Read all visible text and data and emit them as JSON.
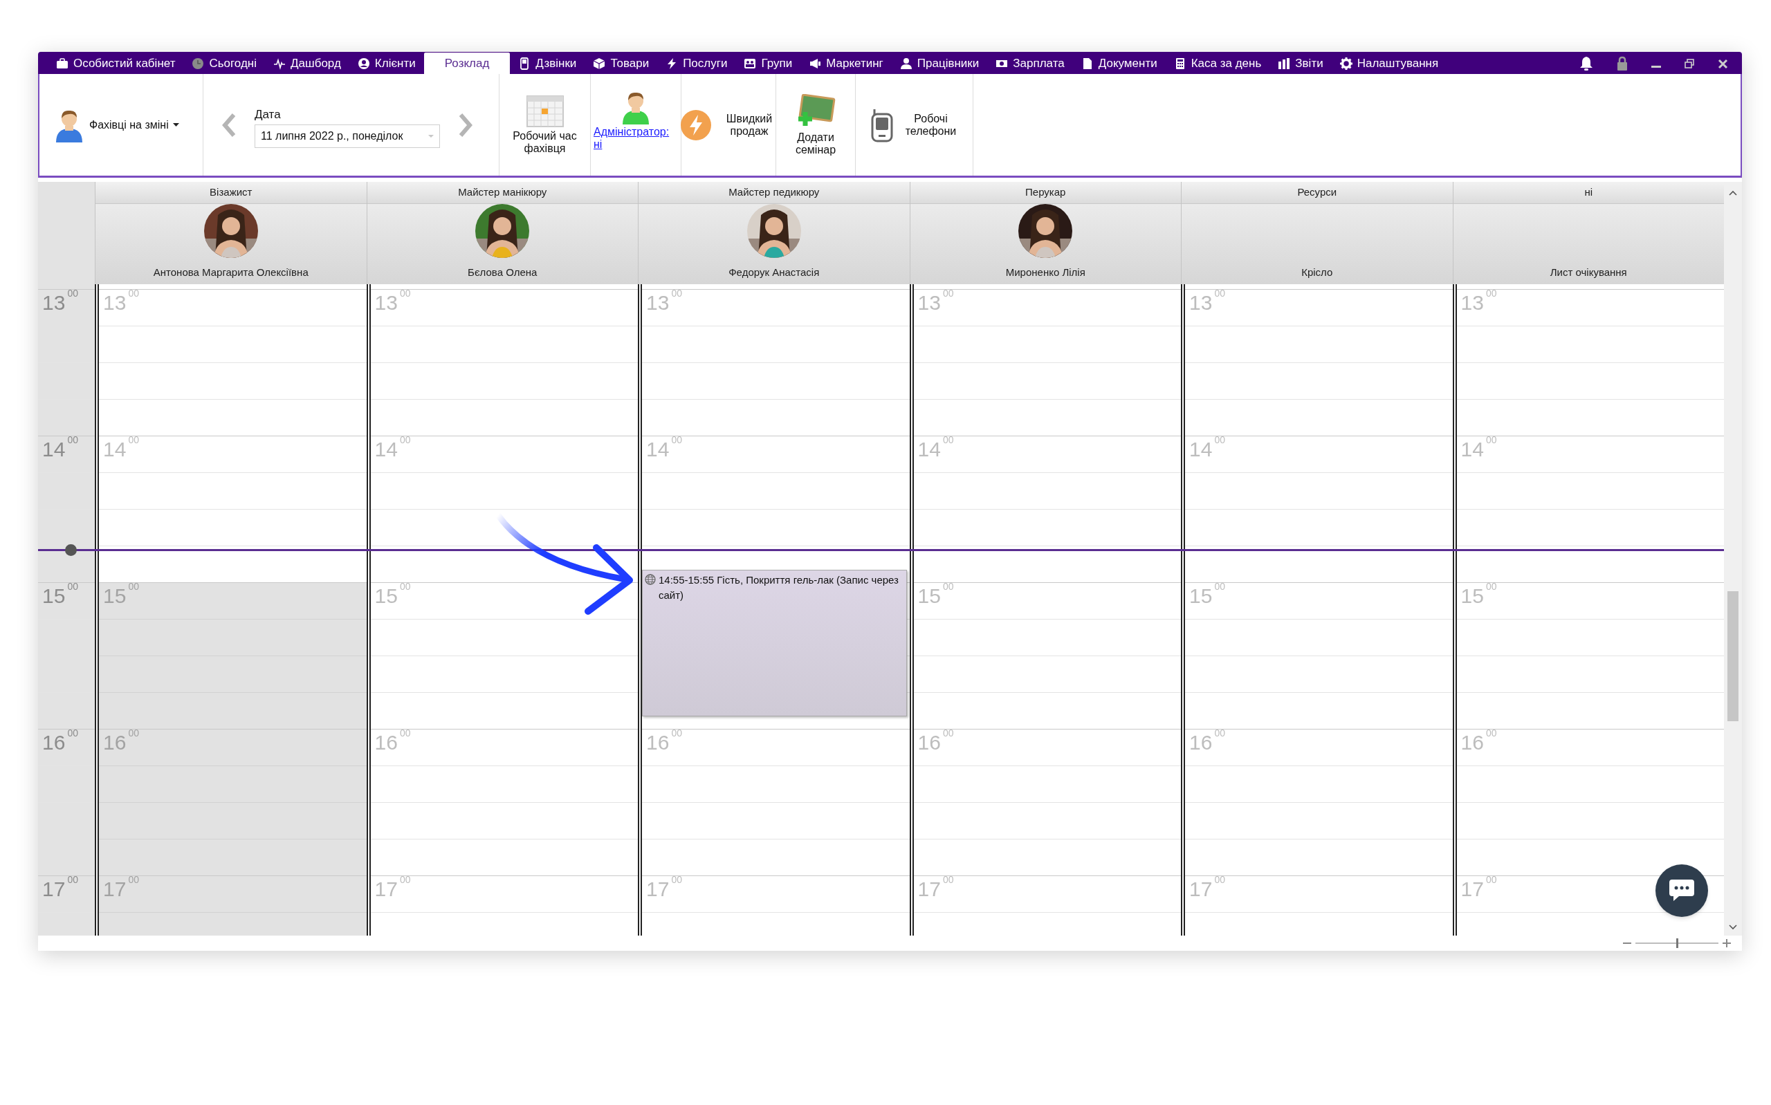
{
  "menu": [
    {
      "label": "Особистий кабінет",
      "selected": false
    },
    {
      "label": "Сьогодні",
      "selected": false
    },
    {
      "label": "Дашборд",
      "selected": false
    },
    {
      "label": "Клієнти",
      "selected": false
    },
    {
      "label": "Розклад",
      "selected": true
    },
    {
      "label": "Дзвінки",
      "selected": false
    },
    {
      "label": "Товари",
      "selected": false
    },
    {
      "label": "Послуги",
      "selected": false
    },
    {
      "label": "Групи",
      "selected": false
    },
    {
      "label": "Маркетинг",
      "selected": false
    },
    {
      "label": "Працівники",
      "selected": false
    },
    {
      "label": "Зарплата",
      "selected": false
    },
    {
      "label": "Документи",
      "selected": false
    },
    {
      "label": "Каса за день",
      "selected": false
    },
    {
      "label": "Звіти",
      "selected": false
    },
    {
      "label": "Налаштування",
      "selected": false
    }
  ],
  "toolbar": {
    "staff_button": "Фахівці на зміні",
    "date_label": "Дата",
    "date_value": "11 липня 2022 р., понеділок",
    "tools": [
      {
        "label": "Робочий час фахівця",
        "kind": "stacked"
      },
      {
        "label": "Адміністратор: ні",
        "kind": "link"
      },
      {
        "label": "Швидкий продаж",
        "kind": "inline"
      },
      {
        "label": "Додати семінар",
        "kind": "stacked"
      },
      {
        "label": "Робочі телефони",
        "kind": "inline"
      }
    ]
  },
  "time_gutter": [
    "13$^{00}$",
    "14$^{00}$",
    "15$^{00}$",
    "16$^{00}$",
    "17$^{00}$"
  ],
  "columns": [
    {
      "role": "Візажист",
      "name": "Антонова Маргарита Олексіївна",
      "photo": true,
      "hours": [
        {
          "label": "13$^{00}$",
          "off": false
        },
        {
          "label": "14$^{00}$",
          "off": false
        },
        {
          "label": "15$^{00}$",
          "off": true
        },
        {
          "label": "16$^{00}$",
          "off": true
        },
        {
          "label": "17$^{00}$",
          "off": true
        }
      ]
    },
    {
      "role": "Майстер манікюру",
      "name": "Бєлова Олена",
      "photo": true,
      "hours": [
        {
          "label": "13$^{00}$",
          "off": false
        },
        {
          "label": "14$^{00}$",
          "off": false
        },
        {
          "label": "15$^{00}$",
          "off": false
        },
        {
          "label": "16$^{00}$",
          "off": false
        },
        {
          "label": "17$^{00}$",
          "off": false
        }
      ]
    },
    {
      "role": "Майстер педикюру",
      "name": "Федорук Анастасія",
      "photo": true,
      "hours": [
        {
          "label": "13$^{00}$",
          "off": false
        },
        {
          "label": "14$^{00}$",
          "off": false
        },
        {
          "off": false
        },
        {
          "label": "16$^{00}$",
          "off": false
        },
        {
          "label": "17$^{00}$",
          "off": false
        }
      ],
      "appointments": [
        {
          "text": "14:55-15:55 Гість, Покриття гель-лак (Запис через сайт)"
        }
      ]
    },
    {
      "role": "Перукар",
      "name": "Мироненко Лілія",
      "photo": true,
      "hours": [
        {
          "label": "13$^{00}$",
          "off": false
        },
        {
          "label": "14$^{00}$",
          "off": false
        },
        {
          "label": "15$^{00}$",
          "off": false
        },
        {
          "label": "16$^{00}$",
          "off": false
        },
        {
          "label": "17$^{00}$",
          "off": false
        }
      ]
    },
    {
      "role": "Ресурси",
      "name": "Крісло",
      "photo": false,
      "hours": [
        {
          "label": "13$^{00}$",
          "off": false
        },
        {
          "label": "14$^{00}$",
          "off": false
        },
        {
          "label": "15$^{00}$",
          "off": false
        },
        {
          "label": "16$^{00}$",
          "off": false
        },
        {
          "label": "17$^{00}$",
          "off": false
        }
      ]
    },
    {
      "role": "ні",
      "name": "Лист очікування",
      "photo": false,
      "hours": [
        {
          "label": "13$^{00}$",
          "off": false
        },
        {
          "label": "14$^{00}$",
          "off": false
        },
        {
          "label": "15$^{00}$",
          "off": false
        },
        {
          "label": "16$^{00}$",
          "off": false
        },
        {
          "label": "17$^{00}$",
          "off": false
        }
      ]
    }
  ],
  "zoom": {
    "level": 0.5
  }
}
